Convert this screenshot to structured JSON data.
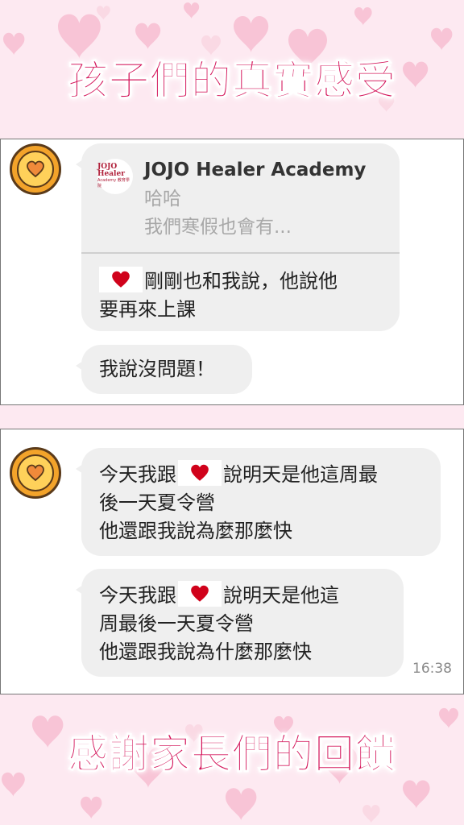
{
  "headings": {
    "top": "孩子們的真實感受",
    "bottom": "感謝家長們的回饋"
  },
  "chat1": {
    "avatar_icon": "heart-coin-icon",
    "quoted": {
      "logo_line1": "JOJO Healer",
      "logo_line2": "Academy 教育學院",
      "sender": "JOJO Healer Academy",
      "line1": "哈哈",
      "line2": "我們寒假也會有..."
    },
    "reply_line1": "剛剛也和我說，他說他",
    "reply_line2": "要再來上課",
    "message2": "我說沒問題！"
  },
  "chat2": {
    "avatar_icon": "heart-coin-icon",
    "msg1": {
      "line1_before": "今天我跟",
      "line1_after": "說明天是他這周最",
      "line2": "後一天夏令營",
      "line3": "他還跟我說為麼那麼快"
    },
    "msg2": {
      "line1_before": "今天我跟",
      "line1_after": "說明天是他這",
      "line2": "周最後一天夏令營",
      "line3": "他還跟我說為什麼那麼快"
    },
    "time": "16:38"
  },
  "colors": {
    "accent": "#d4145a",
    "background": "#fde9f1",
    "bubble": "#efefef",
    "heart": "#d0021b"
  }
}
